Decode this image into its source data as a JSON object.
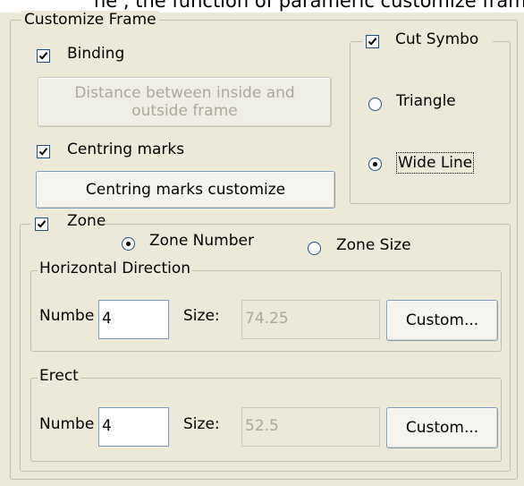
{
  "caption_fragment": "he , the function of parameric customize frame",
  "customize_frame": {
    "title": "Customize Frame",
    "binding": {
      "label": "Binding",
      "checked": true
    },
    "distance_button": "Distance between inside and outside frame",
    "centring_marks": {
      "label": "Centring marks",
      "checked": true
    },
    "centring_button": "Centring marks customize"
  },
  "cut_symbol": {
    "label": "Cut Symbo",
    "checked": true,
    "options": [
      {
        "label": "Triangle",
        "selected": false
      },
      {
        "label": "Wide Line",
        "selected": true
      }
    ]
  },
  "zone": {
    "label": "Zone",
    "checked": true,
    "options": [
      {
        "label": "Zone Number",
        "selected": true
      },
      {
        "label": "Zone Size",
        "selected": false
      }
    ],
    "horizontal": {
      "title": "Horizontal Direction",
      "number_label": "Numbe",
      "number_value": "4",
      "size_label": "Size:",
      "size_value": "74.25",
      "custom_button": "Custom..."
    },
    "erect": {
      "title": "Erect",
      "number_label": "Numbe",
      "number_value": "4",
      "size_label": "Size:",
      "size_value": "52.5",
      "custom_button": "Custom..."
    }
  }
}
